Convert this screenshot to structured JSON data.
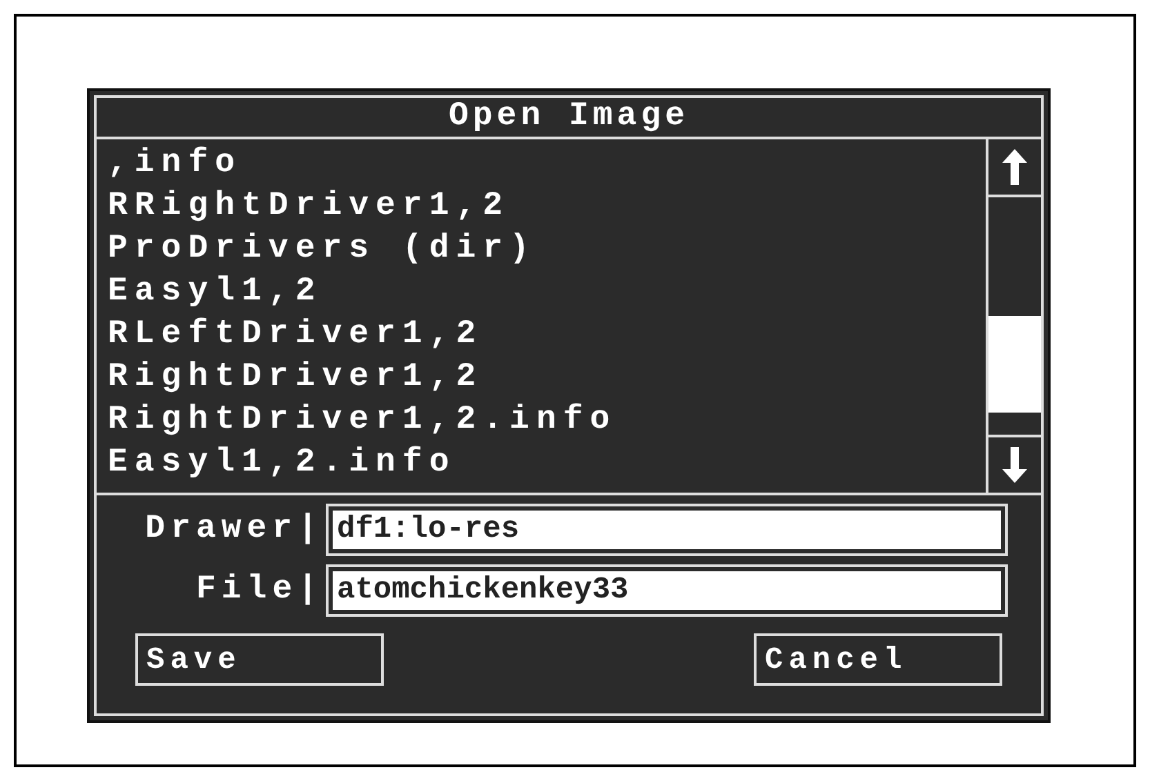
{
  "window": {
    "title": "Open Image"
  },
  "files": [
    {
      "name": ",info"
    },
    {
      "name": "RRightDriver1,2"
    },
    {
      "name": "ProDrivers (dir)"
    },
    {
      "name": "Easyl1,2"
    },
    {
      "name": "RLeftDriver1,2"
    },
    {
      "name": "RightDriver1,2"
    },
    {
      "name": "RightDriver1,2.info"
    },
    {
      "name": "Easyl1,2.info"
    }
  ],
  "fields": [
    {
      "label": "Drawer",
      "separator": "|",
      "value": "df1:lo-res"
    },
    {
      "label": "File",
      "separator": "|",
      "value": "atomchickenkey33"
    }
  ],
  "buttons": [
    {
      "label": "Save"
    },
    {
      "label": "Cancel"
    }
  ]
}
